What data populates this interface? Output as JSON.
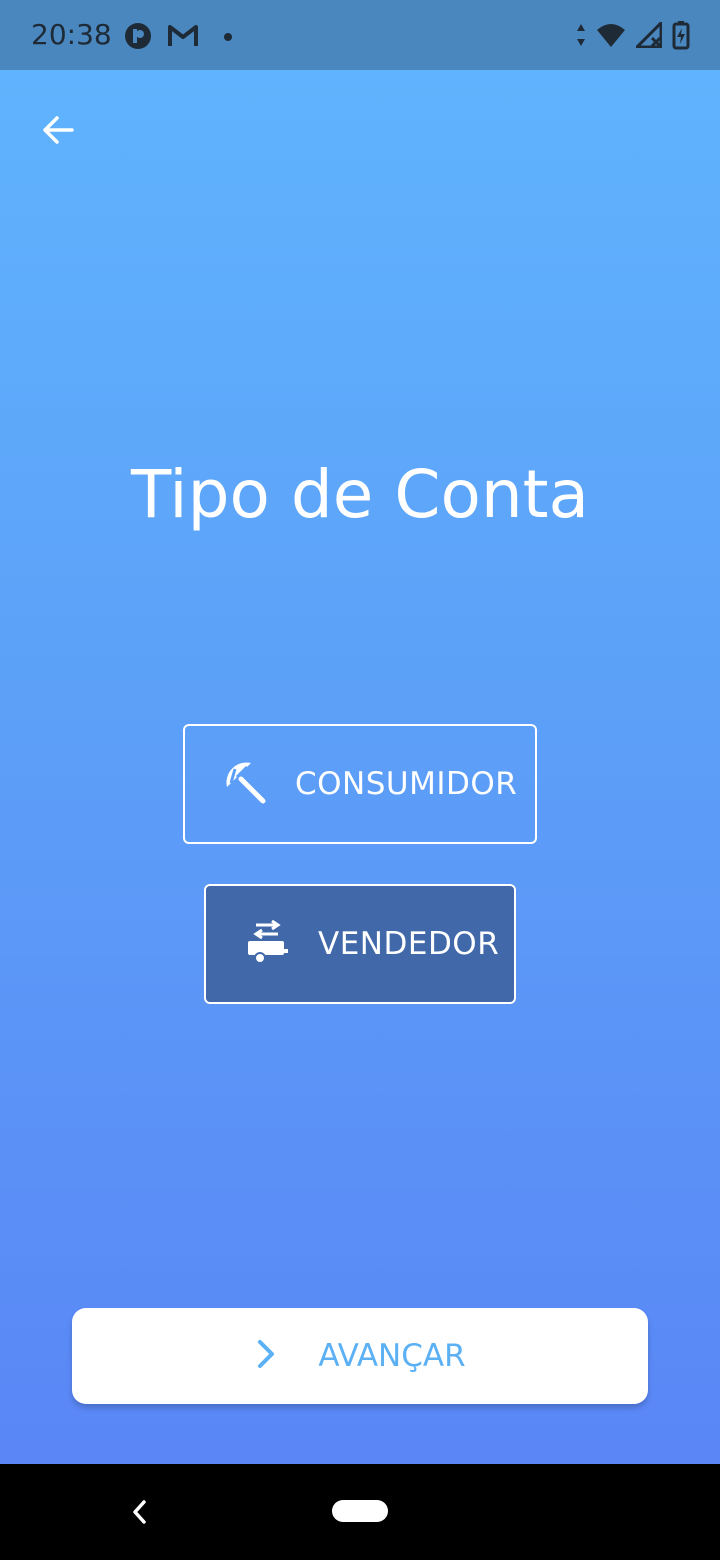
{
  "status_bar": {
    "time": "20:38",
    "icons": [
      "notification-app-icon",
      "gmail-icon",
      "dot-icon",
      "data-arrows-icon",
      "wifi-icon",
      "signal-icon",
      "battery-icon"
    ]
  },
  "header": {
    "back_icon": "arrow-left-icon"
  },
  "main": {
    "title": "Tipo de Conta",
    "options": [
      {
        "label": "CONSUMIDOR",
        "icon": "beach-umbrella-icon",
        "selected": false
      },
      {
        "label": "VENDEDOR",
        "icon": "food-truck-icon",
        "selected": true
      }
    ]
  },
  "footer": {
    "next_label": "AVANÇAR",
    "next_icon": "chevron-right-icon"
  },
  "navigation": {
    "back_icon": "nav-back-icon",
    "home_icon": "nav-home-pill"
  },
  "colors": {
    "status_bar": "#4A87BE",
    "gradient_top": "#60B5FE",
    "gradient_bottom": "#5A86F6",
    "selected_option": "#4168A9",
    "next_text": "#5CB0F4"
  }
}
